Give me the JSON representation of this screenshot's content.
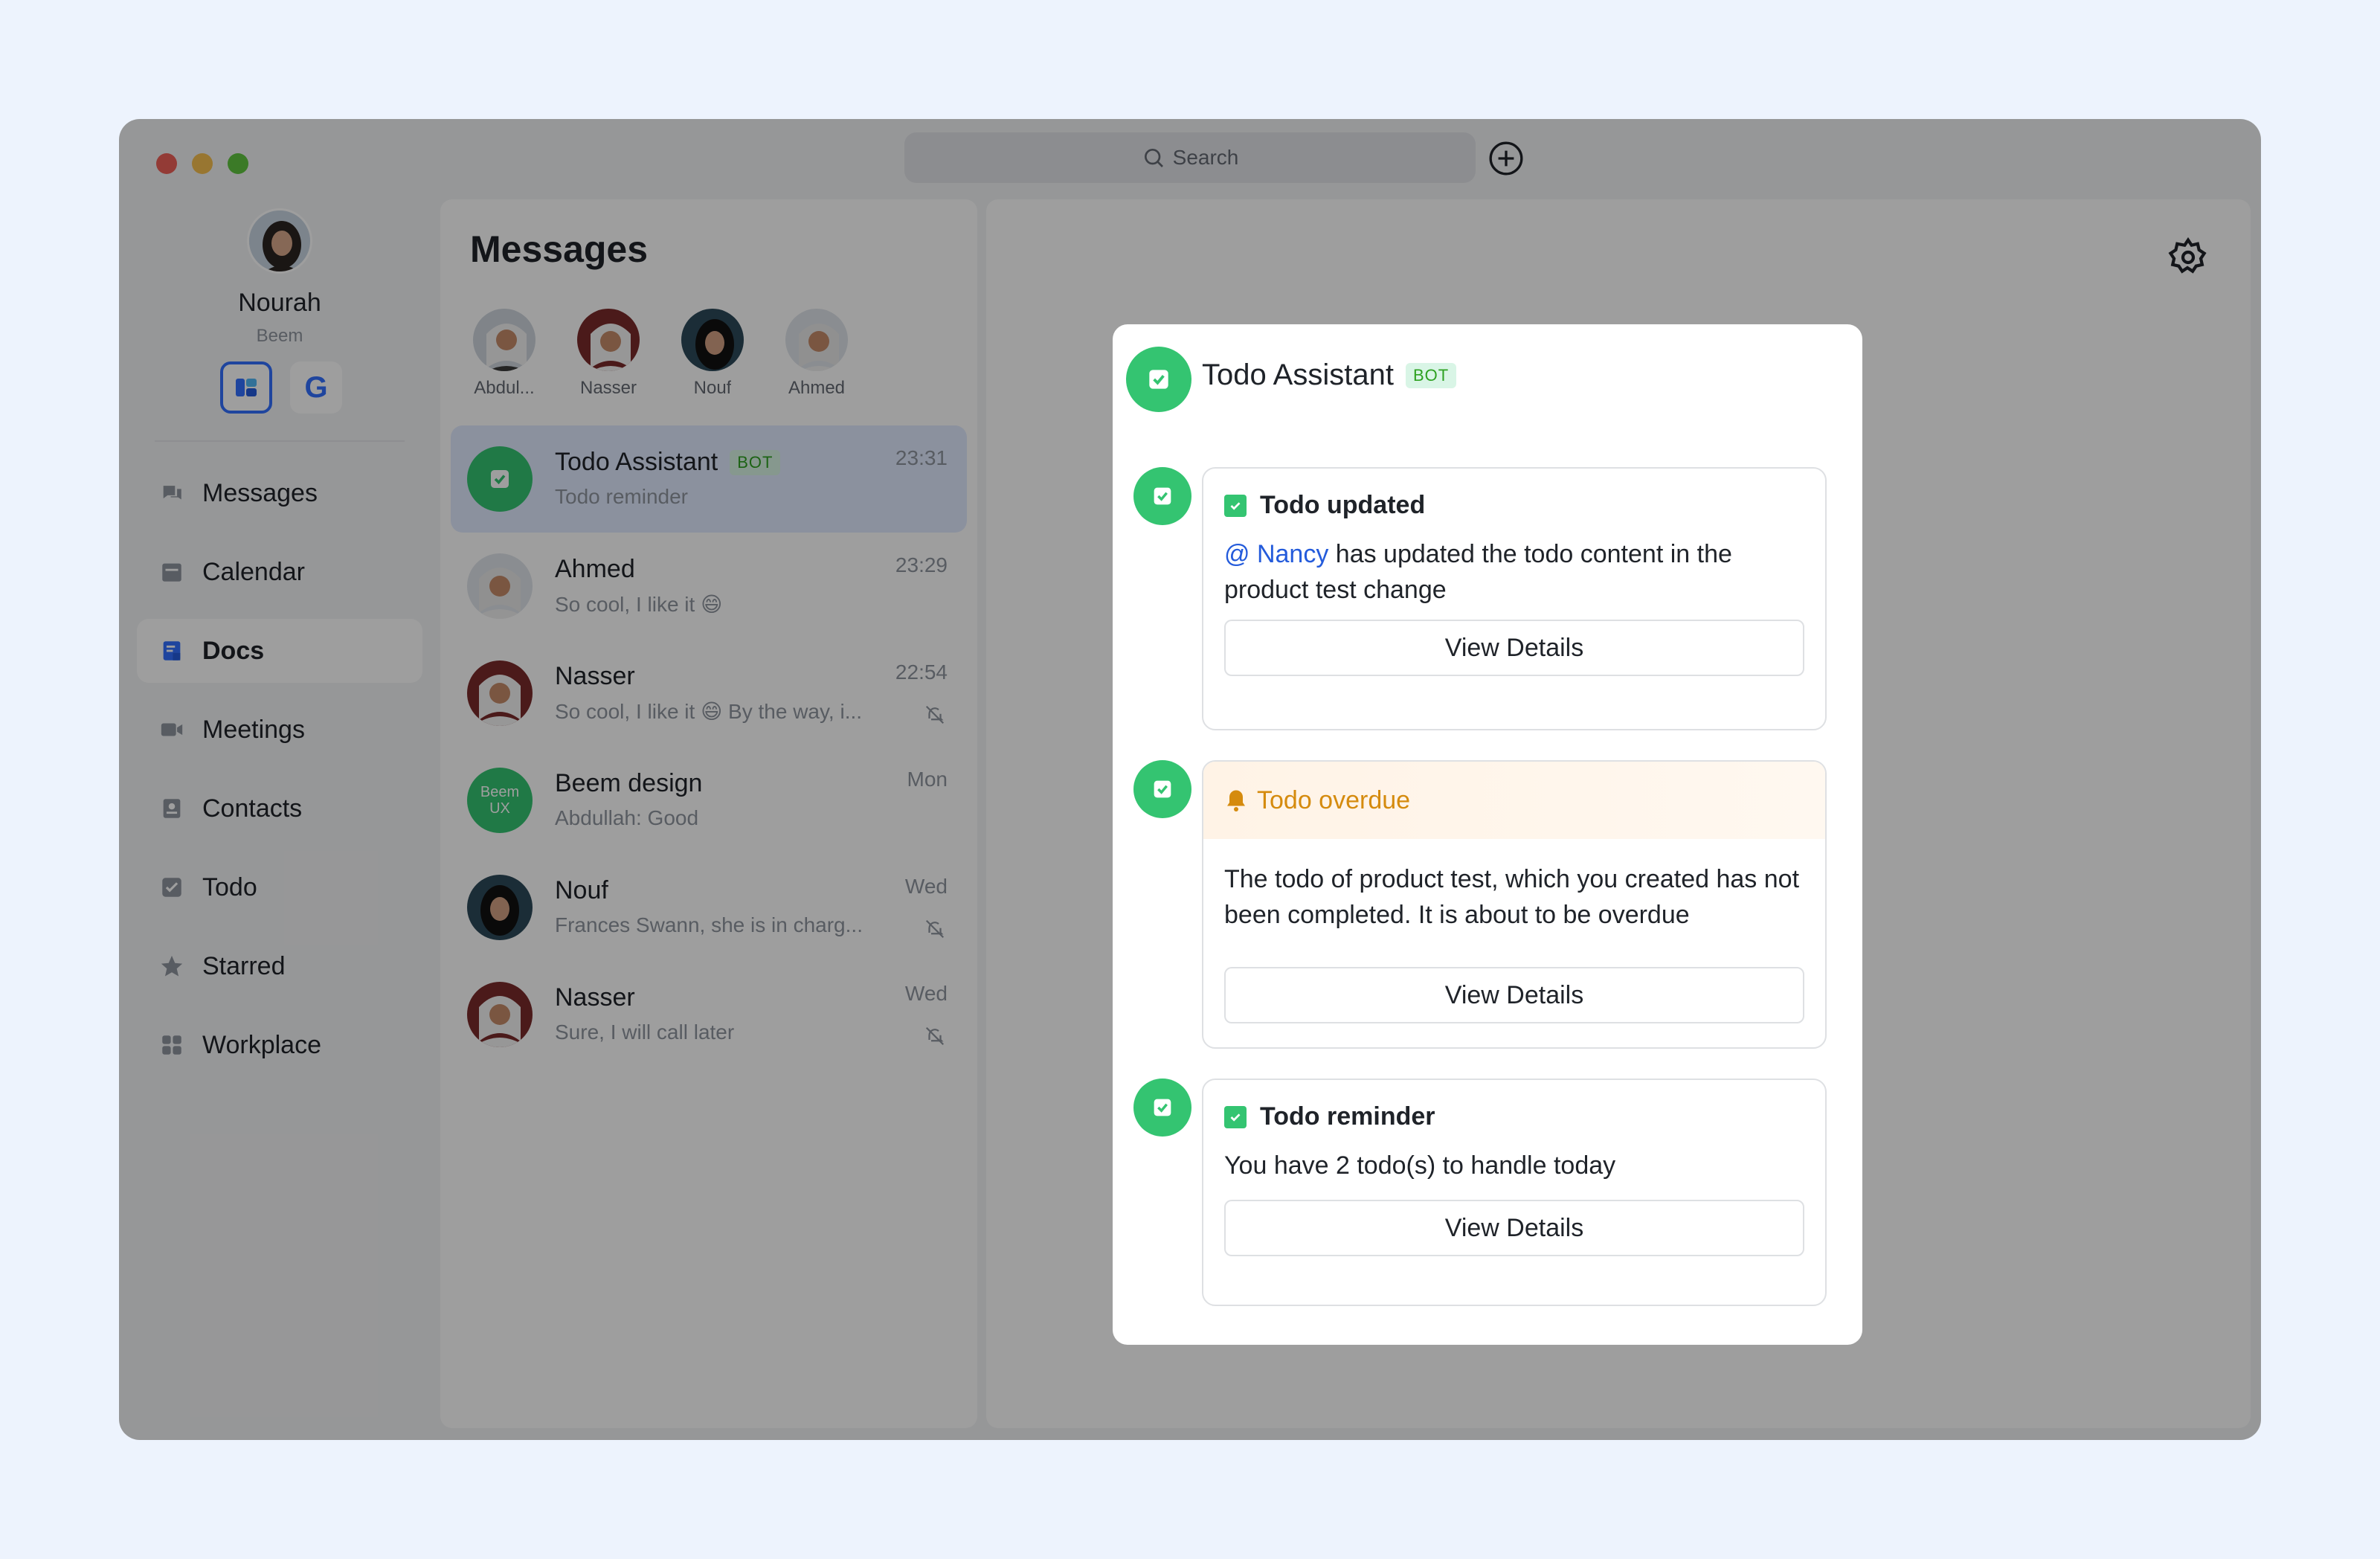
{
  "search": {
    "placeholder": "Search"
  },
  "profile": {
    "name": "Nourah",
    "org": "Beem",
    "org_switch_g": "G"
  },
  "nav": [
    {
      "label": "Messages",
      "icon": "chat-bubbles-icon"
    },
    {
      "label": "Calendar",
      "icon": "calendar-icon"
    },
    {
      "label": "Docs",
      "icon": "docs-icon",
      "active": true
    },
    {
      "label": "Meetings",
      "icon": "video-camera-icon"
    },
    {
      "label": "Contacts",
      "icon": "contacts-icon"
    },
    {
      "label": "Todo",
      "icon": "todo-check-icon"
    },
    {
      "label": "Starred",
      "icon": "star-icon"
    },
    {
      "label": "Workplace",
      "icon": "workplace-grid-icon"
    }
  ],
  "messages_panel": {
    "title": "Messages",
    "stories": [
      {
        "name": "Abdul..."
      },
      {
        "name": "Nasser"
      },
      {
        "name": "Nouf"
      },
      {
        "name": "Ahmed"
      }
    ],
    "chats": [
      {
        "name": "Todo Assistant",
        "badge": "BOT",
        "preview": "Todo reminder",
        "time": "23:31",
        "muted": false
      },
      {
        "name": "Ahmed",
        "badge": "",
        "preview": "So cool, I like it 😄",
        "time": "23:29",
        "muted": false
      },
      {
        "name": "Nasser",
        "badge": "",
        "preview": "So cool, I like it 😄 By the way, i...",
        "time": "22:54",
        "muted": true
      },
      {
        "name": "Beem design",
        "badge": "",
        "preview": "Abdullah: Good",
        "time": "Mon",
        "muted": false,
        "avatar_text": "Beem UX"
      },
      {
        "name": "Nouf",
        "badge": "",
        "preview": "Frances Swann, she is in charg...",
        "time": "Wed",
        "muted": true
      },
      {
        "name": "Nasser",
        "badge": "",
        "preview": "Sure, I will call later",
        "time": "Wed",
        "muted": true
      }
    ]
  },
  "popup": {
    "title": "Todo Assistant",
    "badge": "BOT",
    "cards": [
      {
        "title": "Todo updated",
        "mention": "@ Nancy",
        "body": " has updated the todo content in the product test change",
        "button": "View Details"
      },
      {
        "title": "Todo overdue",
        "body": "The todo of product test, which you created has not been completed. It is about to be overdue",
        "button": "View Details"
      },
      {
        "title": "Todo reminder",
        "body": "You have 2 todo(s) to handle today",
        "button": "View Details"
      }
    ]
  },
  "colors": {
    "accent": "#3370ff",
    "bot_green": "#34c471",
    "warning": "#d58b0e"
  }
}
